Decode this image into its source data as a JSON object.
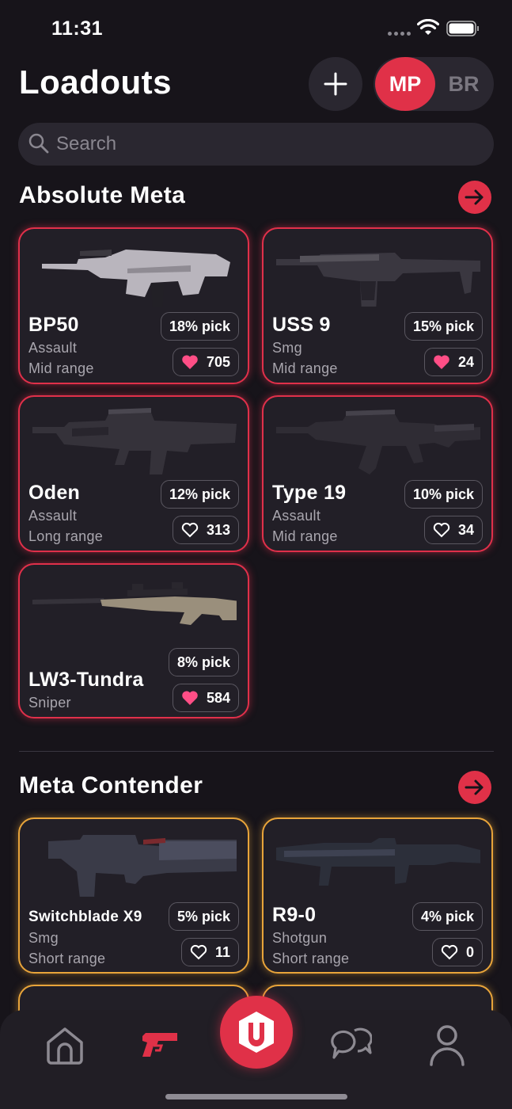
{
  "status_bar": {
    "time": "11:31"
  },
  "header": {
    "title": "Loadouts",
    "add_label": "+",
    "mode_options": [
      "MP",
      "BR"
    ],
    "selected_mode": "MP"
  },
  "search": {
    "placeholder": "Search",
    "value": ""
  },
  "sections": [
    {
      "title": "Absolute Meta",
      "cards": [
        {
          "name": "BP50",
          "category": "Assault",
          "range": "Mid range",
          "pick": "18% pick",
          "likes": "705",
          "liked": true
        },
        {
          "name": "USS 9",
          "category": "Smg",
          "range": "Mid range",
          "pick": "15% pick",
          "likes": "24",
          "liked": true
        },
        {
          "name": "Oden",
          "category": "Assault",
          "range": "Long range",
          "pick": "12% pick",
          "likes": "313",
          "liked": false
        },
        {
          "name": "Type 19",
          "category": "Assault",
          "range": "Mid range",
          "pick": "10% pick",
          "likes": "34",
          "liked": false
        },
        {
          "name": "LW3-Tundra",
          "category": "Sniper",
          "range": "",
          "pick": "8% pick",
          "likes": "584",
          "liked": true
        }
      ]
    },
    {
      "title": "Meta Contender",
      "cards": [
        {
          "name": "Switchblade X9",
          "category": "Smg",
          "range": "Short range",
          "pick": "5% pick",
          "likes": "11",
          "liked": false
        },
        {
          "name": "R9-0",
          "category": "Shotgun",
          "range": "Short range",
          "pick": "4% pick",
          "likes": "0",
          "liked": false
        }
      ]
    }
  ],
  "tab_bar": {
    "items": [
      "home",
      "loadouts",
      "app",
      "chat",
      "profile"
    ],
    "active": "loadouts"
  },
  "colors": {
    "accent": "#e03148",
    "meta_border": "#e0304a",
    "contender_border": "#e8a43a",
    "background": "#17141a",
    "card": "#221f27"
  }
}
